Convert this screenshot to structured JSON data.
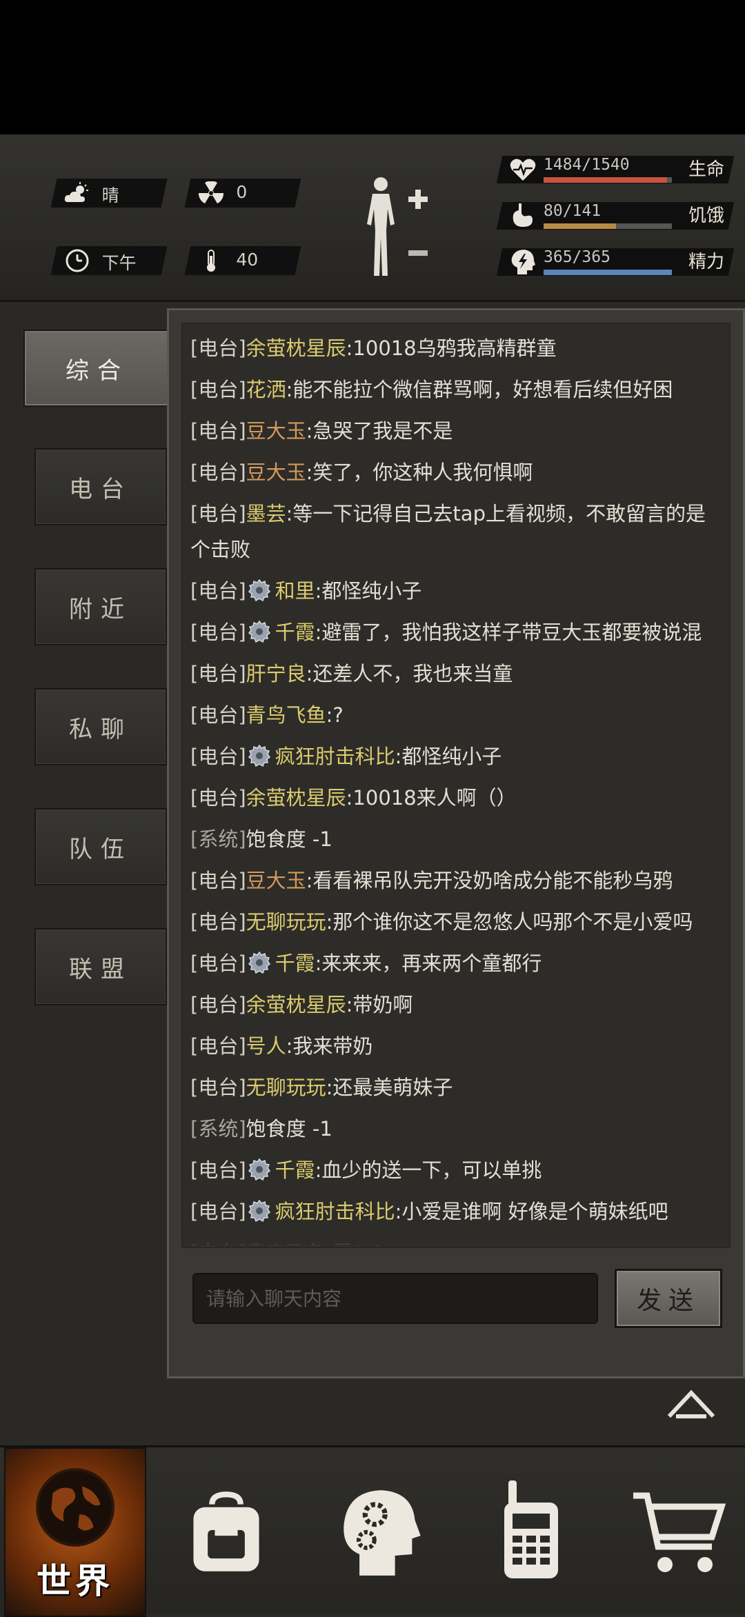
{
  "status": {
    "weather": "晴",
    "radiation": "0",
    "time_of_day": "下午",
    "temperature": "40",
    "health": {
      "value": "1484/1540",
      "label": "生命",
      "fraction": 0.9636,
      "color": "#c9553f"
    },
    "hunger": {
      "value": "80/141",
      "label": "饥饿",
      "fraction": 0.567,
      "color": "#b88a43"
    },
    "energy": {
      "value": "365/365",
      "label": "精力",
      "fraction": 1.0,
      "color": "#5b86b8"
    }
  },
  "tabs": [
    "综合",
    "电台",
    "附近",
    "私聊",
    "队伍",
    "联盟"
  ],
  "active_tab": "综合",
  "messages": [
    {
      "channel": "[电台]",
      "badge": false,
      "name": "余萤枕星辰",
      "name_color": "y",
      "text": ":10018乌鸦我高精群童"
    },
    {
      "channel": "[电台]",
      "badge": false,
      "name": "花洒",
      "name_color": "y",
      "text": ":能不能拉个微信群骂啊，好想看后续但好困"
    },
    {
      "channel": "[电台]",
      "badge": false,
      "name": "豆大玉",
      "name_color": "o",
      "text": ":急哭了我是不是"
    },
    {
      "channel": "[电台]",
      "badge": false,
      "name": "豆大玉",
      "name_color": "o",
      "text": ":笑了，你这种人我何惧啊"
    },
    {
      "channel": "[电台]",
      "badge": false,
      "name": "墨芸",
      "name_color": "y",
      "text": ":等一下记得自己去tap上看视频，不敢留言的是个击败"
    },
    {
      "channel": "[电台]",
      "badge": true,
      "name": "和里",
      "name_color": "y",
      "text": ":都怪纯小子"
    },
    {
      "channel": "[电台]",
      "badge": true,
      "name": "千霞",
      "name_color": "y",
      "text": ":避雷了，我怕我这样子带豆大玉都要被说混"
    },
    {
      "channel": "[电台]",
      "badge": false,
      "name": "肝宁良",
      "name_color": "y",
      "text": ":还差人不，我也来当童"
    },
    {
      "channel": "[电台]",
      "badge": false,
      "name": "青鸟飞鱼",
      "name_color": "y",
      "text": ":?"
    },
    {
      "channel": "[电台]",
      "badge": true,
      "name": "疯狂肘击科比",
      "name_color": "y",
      "text": ":都怪纯小子"
    },
    {
      "channel": "[电台]",
      "badge": false,
      "name": "余萤枕星辰",
      "name_color": "y",
      "text": ":10018来人啊（）"
    },
    {
      "channel": "[系统]",
      "badge": false,
      "name": "",
      "name_color": "",
      "text": "饱食度 -1"
    },
    {
      "channel": "[电台]",
      "badge": false,
      "name": "豆大玉",
      "name_color": "o",
      "text": ":看看裸吊队完开没奶啥成分能不能秒乌鸦"
    },
    {
      "channel": "[电台]",
      "badge": false,
      "name": "无聊玩玩",
      "name_color": "y",
      "text": ":那个谁你这不是忽悠人吗那个不是小爱吗"
    },
    {
      "channel": "[电台]",
      "badge": true,
      "name": "千霞",
      "name_color": "y",
      "text": ":来来来，再来两个童都行"
    },
    {
      "channel": "[电台]",
      "badge": false,
      "name": "余萤枕星辰",
      "name_color": "y",
      "text": ":带奶啊"
    },
    {
      "channel": "[电台]",
      "badge": false,
      "name": "号人",
      "name_color": "y",
      "text": ":我来带奶"
    },
    {
      "channel": "[电台]",
      "badge": false,
      "name": "无聊玩玩",
      "name_color": "y",
      "text": ":还最美萌妹子"
    },
    {
      "channel": "[系统]",
      "badge": false,
      "name": "",
      "name_color": "",
      "text": "饱食度 -1"
    },
    {
      "channel": "[电台]",
      "badge": true,
      "name": "千霞",
      "name_color": "y",
      "text": ":血少的送一下，可以单挑"
    },
    {
      "channel": "[电台]",
      "badge": true,
      "name": "疯狂肘击科比",
      "name_color": "y",
      "text": ":小爱是谁啊 好像是个萌妹纸吧"
    },
    {
      "channel": "[电台]",
      "badge": false,
      "name": "青鸟飞鱼",
      "name_color": "y",
      "text": ":露！！"
    }
  ],
  "input": {
    "placeholder": "请输入聊天内容",
    "value": ""
  },
  "send_label": "发送",
  "nav": {
    "world_label": "世界",
    "items": [
      "globe-icon",
      "backpack-icon",
      "skills-head-icon",
      "radio-icon",
      "cart-icon"
    ]
  }
}
